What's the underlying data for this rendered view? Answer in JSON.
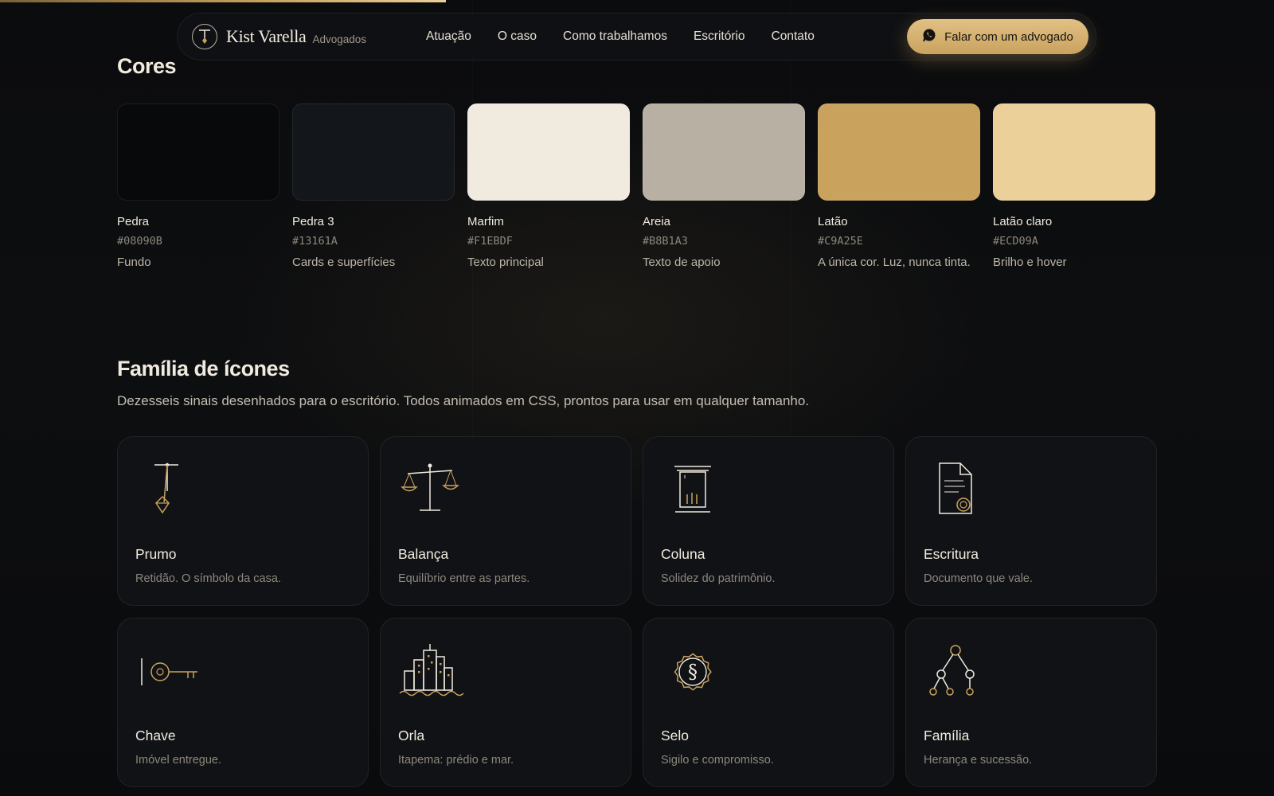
{
  "progress": {
    "fraction": 0.35
  },
  "nav": {
    "brand_name": "Kist Varella",
    "brand_sub": "Advogados",
    "items": [
      "Atuação",
      "O caso",
      "Como trabalhamos",
      "Escritório",
      "Contato"
    ],
    "cta_label": "Falar com um advogado",
    "cta_icon": "whatsapp-icon"
  },
  "colors_section": {
    "title": "Cores",
    "swatches": [
      {
        "name": "Pedra",
        "hex": "#08090B",
        "desc": "Fundo",
        "color": "#08090b"
      },
      {
        "name": "Pedra 3",
        "hex": "#13161A",
        "desc": "Cards e superfícies",
        "color": "#13161a"
      },
      {
        "name": "Marfim",
        "hex": "#F1EBDF",
        "desc": "Texto principal",
        "color": "#f1ebdf"
      },
      {
        "name": "Areia",
        "hex": "#B8B1A3",
        "desc": "Texto de apoio",
        "color": "#b8b1a3"
      },
      {
        "name": "Latão",
        "hex": "#C9A25E",
        "desc": "A única cor. Luz, nunca tinta.",
        "color": "#c9a25e"
      },
      {
        "name": "Latão claro",
        "hex": "#ECD09A",
        "desc": "Brilho e hover",
        "color": "#ecd09a"
      }
    ]
  },
  "icons_section": {
    "title": "Família de ícones",
    "description": "Dezesseis sinais desenhados para o escritório. Todos animados em CSS, prontos para usar em qualquer tamanho.",
    "cards": [
      {
        "icon": "plumb-bob-icon",
        "title": "Prumo",
        "desc": "Retidão. O símbolo da casa."
      },
      {
        "icon": "scales-icon",
        "title": "Balança",
        "desc": "Equilíbrio entre as partes."
      },
      {
        "icon": "column-icon",
        "title": "Coluna",
        "desc": "Solidez do patrimônio."
      },
      {
        "icon": "document-seal-icon",
        "title": "Escritura",
        "desc": "Documento que vale."
      },
      {
        "icon": "key-icon",
        "title": "Chave",
        "desc": "Imóvel entregue."
      },
      {
        "icon": "city-waves-icon",
        "title": "Orla",
        "desc": "Itapema: prédio e mar."
      },
      {
        "icon": "section-seal-icon",
        "title": "Selo",
        "desc": "Sigilo e compromisso."
      },
      {
        "icon": "family-tree-icon",
        "title": "Família",
        "desc": "Herança e sucessão."
      }
    ]
  },
  "theme": {
    "gold": "#c9a25e",
    "gold_light": "#ecd09a",
    "ivory": "#f1ebdf",
    "sand": "#b8b1a3",
    "bg": "#08090b"
  }
}
